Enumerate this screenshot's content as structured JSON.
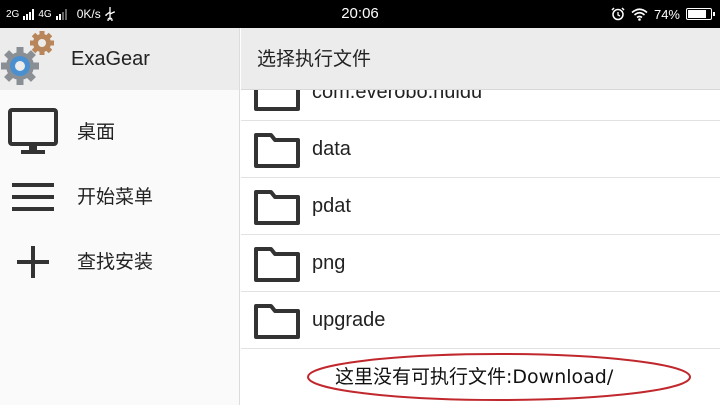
{
  "status_bar": {
    "net1": "2G",
    "net2": "4G",
    "speed": "0K/s",
    "time": "20:06",
    "battery_percent_label": "74%",
    "battery_level": 0.74,
    "icons": [
      "signal-icon",
      "usb-icon",
      "alarm-icon",
      "wifi-icon",
      "battery-icon"
    ]
  },
  "drawer": {
    "app_title": "ExaGear",
    "items": [
      {
        "label": "桌面",
        "icon": "monitor-icon"
      },
      {
        "label": "开始菜单",
        "icon": "menu-icon"
      },
      {
        "label": "查找安装",
        "icon": "plus-icon"
      }
    ]
  },
  "main": {
    "title": "选择执行文件",
    "files": [
      {
        "name": "com.everobo.huidu"
      },
      {
        "name": "data"
      },
      {
        "name": "pdat"
      },
      {
        "name": "png"
      },
      {
        "name": "upgrade"
      }
    ],
    "empty_message": "这里没有可执行文件:Download/"
  },
  "colors": {
    "header_bg": "#ececec",
    "annotation_red": "#c0282d"
  }
}
